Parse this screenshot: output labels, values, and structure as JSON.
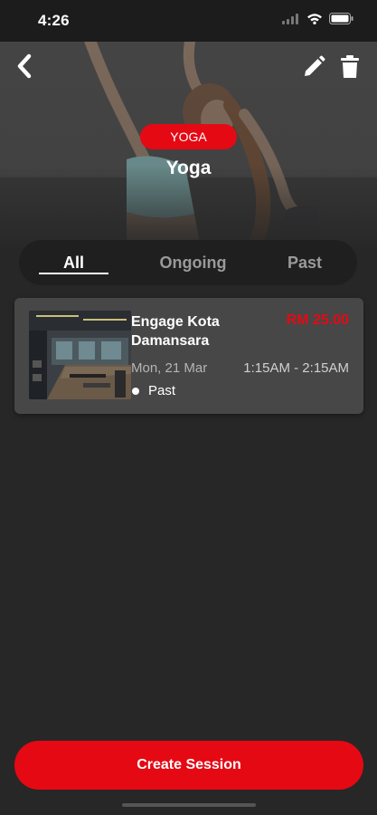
{
  "status_bar": {
    "time": "4:26"
  },
  "hero": {
    "category_badge": "YOGA",
    "title": "Yoga"
  },
  "tabs": [
    {
      "label": "All",
      "active": true
    },
    {
      "label": "Ongoing",
      "active": false
    },
    {
      "label": "Past",
      "active": false
    }
  ],
  "sessions": [
    {
      "venue": "Engage Kota Damansara",
      "price": "RM 25.00",
      "date": "Mon, 21 Mar",
      "time": "1:15AM - 2:15AM",
      "status": "Past"
    }
  ],
  "actions": {
    "create_label": "Create Session"
  },
  "colors": {
    "accent": "#e50914",
    "background": "#272727",
    "card": "#474747"
  }
}
